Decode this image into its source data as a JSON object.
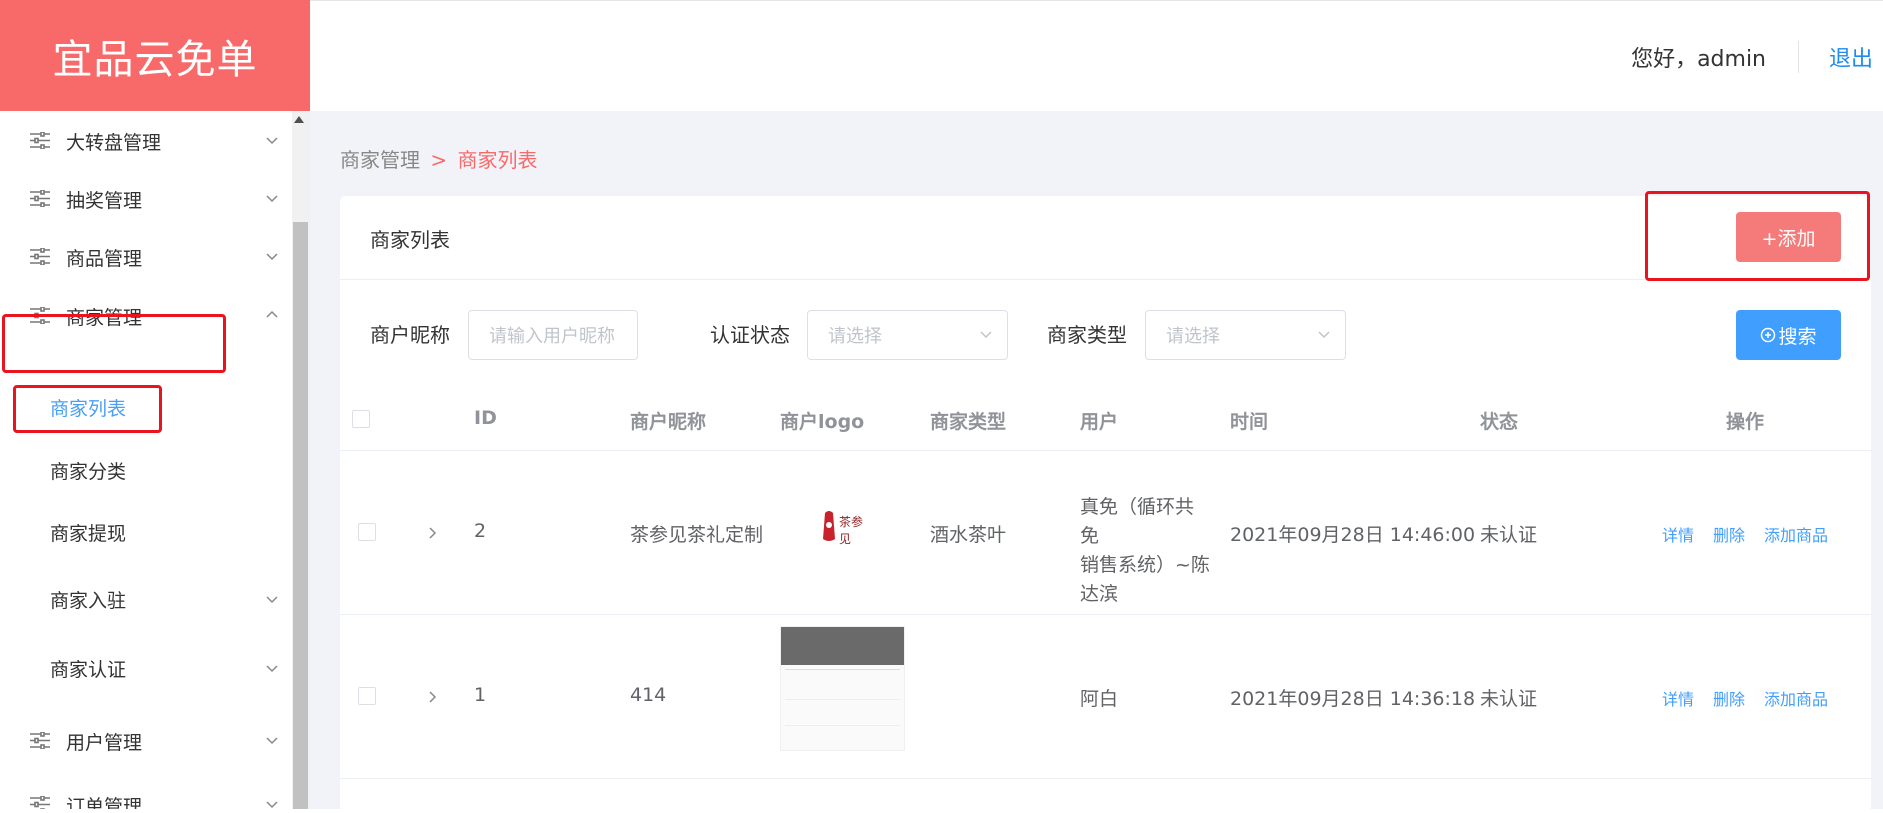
{
  "app": {
    "title": "宜品云免单"
  },
  "topbar": {
    "greeting": "您好，admin",
    "logout": "退出"
  },
  "sidebar": {
    "items": [
      {
        "label": "大转盘管理",
        "arrow": "down"
      },
      {
        "label": "抽奖管理",
        "arrow": "down"
      },
      {
        "label": "商品管理",
        "arrow": "down"
      },
      {
        "label": "商家管理",
        "arrow": "up"
      },
      {
        "label": "用户管理",
        "arrow": "down"
      },
      {
        "label": "订单管理",
        "arrow": "down"
      }
    ],
    "sub_items": [
      {
        "label": "商家列表",
        "active": true
      },
      {
        "label": "商家分类"
      },
      {
        "label": "商家提现"
      },
      {
        "label": "商家入驻",
        "arrow": "down"
      },
      {
        "label": "商家认证",
        "arrow": "down"
      }
    ]
  },
  "breadcrumb": {
    "parent": "商家管理",
    "separator": ">",
    "current": "商家列表"
  },
  "card": {
    "title": "商家列表",
    "add_label": "+添加"
  },
  "filters": {
    "nickname_label": "商户昵称",
    "nickname_placeholder": "请输入用户昵称",
    "auth_label": "认证状态",
    "auth_placeholder": "请选择",
    "type_label": "商家类型",
    "type_placeholder": "请选择",
    "search_label": "搜索"
  },
  "table": {
    "columns": [
      "ID",
      "商户昵称",
      "商户logo",
      "商家类型",
      "用户",
      "时间",
      "状态",
      "操作"
    ],
    "rows": [
      {
        "id": "2",
        "nickname": "茶参见茶礼定制",
        "logo": "茶参见",
        "type": "酒水茶叶",
        "user_line1": "真免（循环共免",
        "user_line2": "销售系统）~陈",
        "user_line3": "达滨",
        "time": "2021年09月28日 14:46:00",
        "status": "未认证",
        "actions": [
          "详情",
          "删除",
          "添加商品"
        ]
      },
      {
        "id": "1",
        "nickname": "414",
        "logo": "",
        "type": "",
        "user_line1": "阿白",
        "user_line2": "",
        "user_line3": "",
        "time": "2021年09月28日 14:36:18",
        "status": "未认证",
        "actions": [
          "详情",
          "删除",
          "添加商品"
        ]
      }
    ]
  },
  "colors": {
    "brand": "#f86a6a",
    "primary": "#409eff",
    "highlight": "#e8141f"
  }
}
